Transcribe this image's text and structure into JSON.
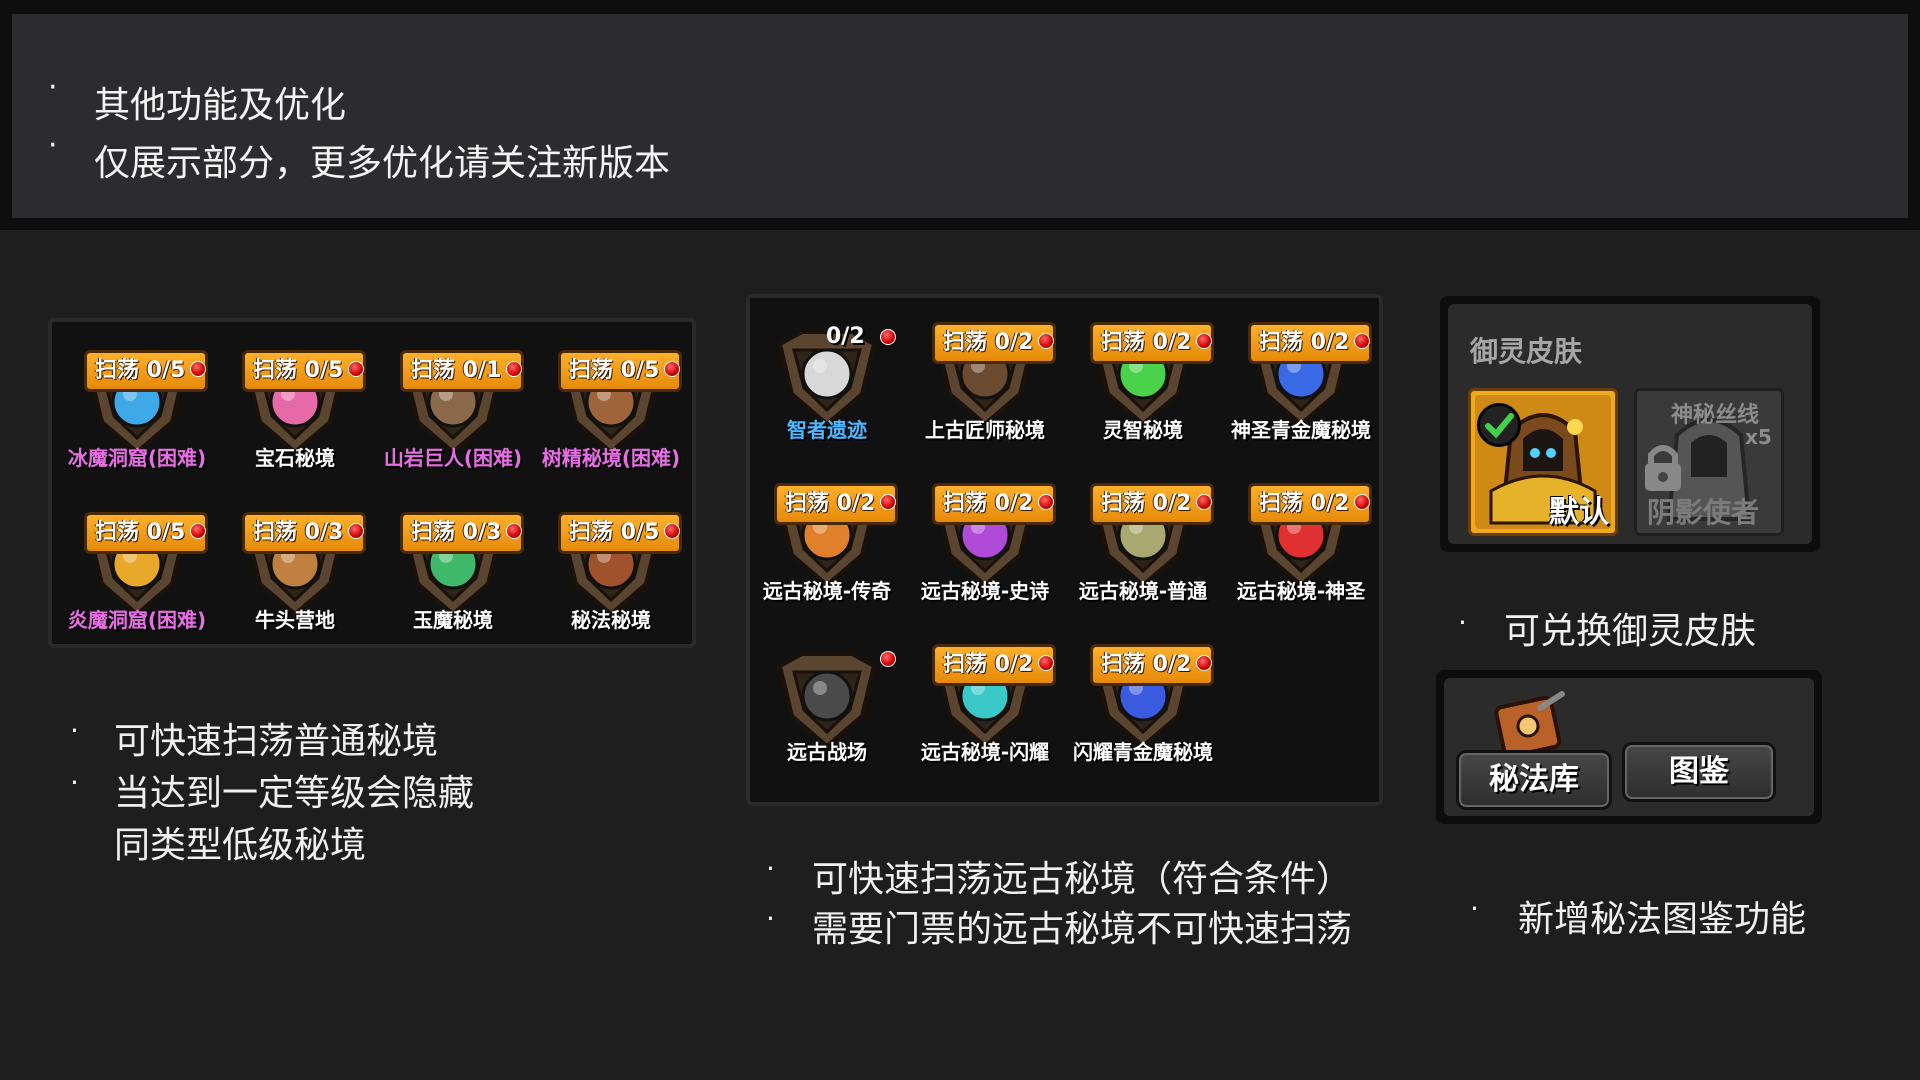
{
  "header": {
    "bullets": [
      "其他功能及优化",
      "仅展示部分，更多优化请关注新版本"
    ]
  },
  "left_panel": {
    "cells": [
      {
        "sweep": "扫荡 0/5",
        "label": "冰魔洞窟(困难)",
        "label_color": "pink",
        "icon": "ice-crystal-icon"
      },
      {
        "sweep": "扫荡 0/5",
        "label": "宝石秘境",
        "label_color": "white",
        "icon": "pink-gem-icon"
      },
      {
        "sweep": "扫荡 0/1",
        "label": "山岩巨人(困难)",
        "label_color": "pink",
        "icon": "rock-giant-icon"
      },
      {
        "sweep": "扫荡 0/5",
        "label": "树精秘境(困难)",
        "label_color": "pink",
        "icon": "tree-spirit-icon"
      },
      {
        "sweep": "扫荡 0/5",
        "label": "炎魔洞窟(困难)",
        "label_color": "pink",
        "icon": "fire-demon-icon"
      },
      {
        "sweep": "扫荡 0/3",
        "label": "牛头营地",
        "label_color": "white",
        "icon": "minotaur-icon"
      },
      {
        "sweep": "扫荡 0/3",
        "label": "玉魔秘境",
        "label_color": "white",
        "icon": "jade-demon-icon"
      },
      {
        "sweep": "扫荡 0/5",
        "label": "秘法秘境",
        "label_color": "white",
        "icon": "arcane-icon"
      }
    ],
    "notes": [
      "可快速扫荡普通秘境",
      "当达到一定等级会隐藏",
      "同类型低级秘境"
    ]
  },
  "middle_panel": {
    "cells": [
      {
        "sweep": "0/2",
        "label": "智者遗迹",
        "label_color": "blue",
        "icon": "sage-ruins-icon",
        "plain": true
      },
      {
        "sweep": "扫荡 0/2",
        "label": "上古匠师秘境",
        "label_color": "white",
        "icon": "ancient-smith-icon"
      },
      {
        "sweep": "扫荡 0/2",
        "label": "灵智秘境",
        "label_color": "white",
        "icon": "green-spirit-icon"
      },
      {
        "sweep": "扫荡 0/2",
        "label": "神圣青金魔秘境",
        "label_color": "white",
        "icon": "holy-lapis-icon"
      },
      {
        "sweep": "扫荡 0/2",
        "label": "远古秘境-传奇",
        "label_color": "white",
        "icon": "ancient-legend-icon"
      },
      {
        "sweep": "扫荡 0/2",
        "label": "远古秘境-史诗",
        "label_color": "white",
        "icon": "ancient-epic-icon"
      },
      {
        "sweep": "扫荡 0/2",
        "label": "远古秘境-普通",
        "label_color": "white",
        "icon": "ancient-normal-icon"
      },
      {
        "sweep": "扫荡 0/2",
        "label": "远古秘境-神圣",
        "label_color": "white",
        "icon": "ancient-holy-icon"
      },
      {
        "sweep": "",
        "label": "远古战场",
        "label_color": "white",
        "icon": "dragon-icon",
        "dot_only": true
      },
      {
        "sweep": "扫荡 0/2",
        "label": "远古秘境-闪耀",
        "label_color": "white",
        "icon": "ancient-shine-icon"
      },
      {
        "sweep": "扫荡 0/2",
        "label": "闪耀青金魔秘境",
        "label_color": "white",
        "icon": "shine-lapis-icon"
      }
    ],
    "notes": [
      "可快速扫荡远古秘境（符合条件）",
      "需要门票的远古秘境不可快速扫荡"
    ]
  },
  "skin_panel": {
    "title": "御灵皮肤",
    "default_label": "默认",
    "locked_label": "阴影使者",
    "locked_item": "神秘丝线",
    "locked_count": "x5",
    "note": "可兑换御灵皮肤"
  },
  "arcane_panel": {
    "library_button": "秘法库",
    "codex_button": "图鉴",
    "note": "新增秘法图鉴功能"
  },
  "colors": {
    "sweep_orange": "#f29a12",
    "pink_label": "#e86ee6",
    "blue_label": "#4fb7ff",
    "skin_gold": "#f0a81c"
  }
}
